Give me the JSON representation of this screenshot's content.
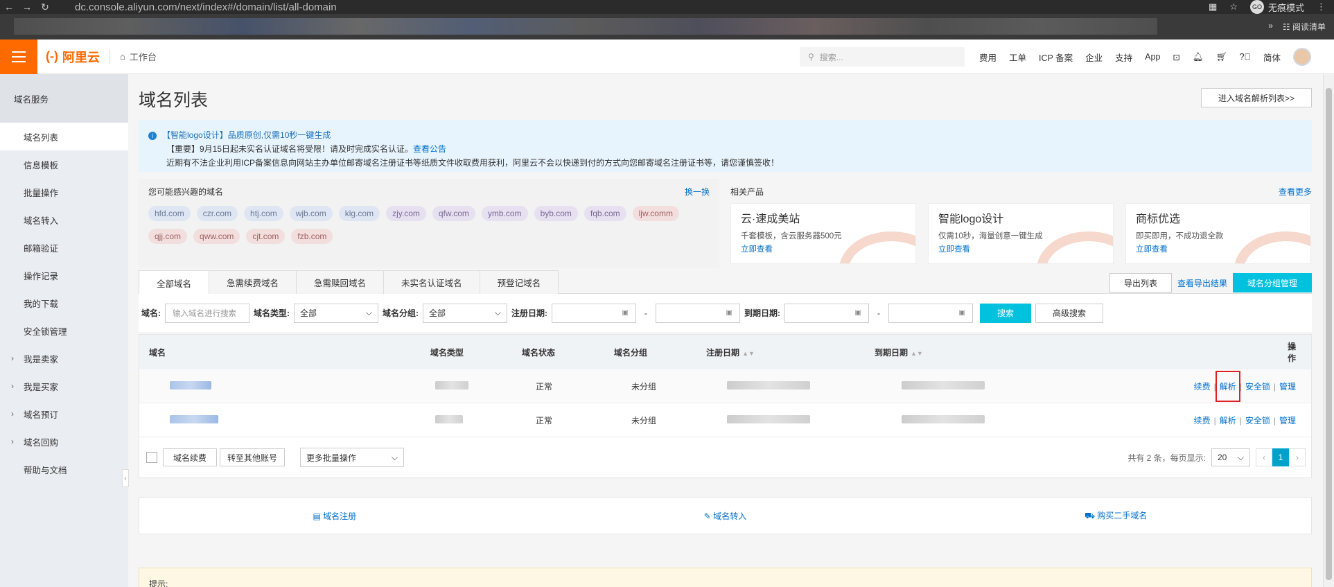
{
  "browser": {
    "url": "dc.console.aliyun.com/next/index#/domain/list/all-domain",
    "incognito_label": "无痕模式",
    "reading_list": "阅读清单",
    "incognito_badge": "GO"
  },
  "topbar": {
    "logo_mark": "(-)",
    "logo_text": "阿里云",
    "workbench": "工作台",
    "search_placeholder": "搜索...",
    "links": [
      "费用",
      "工单",
      "ICP 备案",
      "企业",
      "支持",
      "App"
    ],
    "lang": "简体"
  },
  "sidebar": {
    "title": "域名服务",
    "items": [
      {
        "label": "域名列表",
        "active": true,
        "group": false
      },
      {
        "label": "信息模板",
        "active": false,
        "group": false
      },
      {
        "label": "批量操作",
        "active": false,
        "group": false
      },
      {
        "label": "域名转入",
        "active": false,
        "group": false
      },
      {
        "label": "邮箱验证",
        "active": false,
        "group": false
      },
      {
        "label": "操作记录",
        "active": false,
        "group": false
      },
      {
        "label": "我的下载",
        "active": false,
        "group": false
      },
      {
        "label": "安全锁管理",
        "active": false,
        "group": false
      },
      {
        "label": "我是卖家",
        "active": false,
        "group": true
      },
      {
        "label": "我是买家",
        "active": false,
        "group": true
      },
      {
        "label": "域名预订",
        "active": false,
        "group": true
      },
      {
        "label": "域名回购",
        "active": false,
        "group": true
      },
      {
        "label": "帮助与文档",
        "active": false,
        "group": false
      }
    ]
  },
  "main": {
    "title": "域名列表",
    "top_right_button": "进入域名解析列表>>",
    "notice": {
      "line1": "【智能logo设计】品质原创,仅需10秒一键生成",
      "line2": "【重要】9月15日起未实名认证域名将受限！请及时完成实名认证。",
      "line2_link": "查看公告",
      "line3": "近期有不法企业利用ICP备案信息向网站主办单位邮寄域名注册证书等纸质文件收取费用获利，阿里云不会以快递到付的方式向您邮寄域名注册证书等，请您谨慎签收！"
    },
    "interest": {
      "title": "您可能感兴趣的域名",
      "refresh": "换一换",
      "tags": [
        {
          "text": "hfd.com",
          "tone": "blue"
        },
        {
          "text": "czr.com",
          "tone": "blue"
        },
        {
          "text": "htj.com",
          "tone": "blue"
        },
        {
          "text": "wjb.com",
          "tone": "blue"
        },
        {
          "text": "klg.com",
          "tone": "blue"
        },
        {
          "text": "zjy.com",
          "tone": "purple"
        },
        {
          "text": "qfw.com",
          "tone": "purple"
        },
        {
          "text": "ymb.com",
          "tone": "purple"
        },
        {
          "text": "byb.com",
          "tone": "purple"
        },
        {
          "text": "fqb.com",
          "tone": "purple"
        },
        {
          "text": "ljw.comm",
          "tone": "pink"
        },
        {
          "text": "qjj.com",
          "tone": "pink"
        },
        {
          "text": "qww.com",
          "tone": "pink"
        },
        {
          "text": "cjt.com",
          "tone": "pink"
        },
        {
          "text": "fzb.com",
          "tone": "pink"
        }
      ]
    },
    "related": {
      "title": "相关产品",
      "more": "查看更多",
      "cards": [
        {
          "title": "云·速成美站",
          "desc": "千套模板，含云服务器500元",
          "link": "立即查看"
        },
        {
          "title": "智能logo设计",
          "desc": "仅需10秒，海量创意一键生成",
          "link": "立即查看"
        },
        {
          "title": "商标优选",
          "desc": "即买即用，不成功退全款",
          "link": "立即查看"
        }
      ]
    },
    "tabs": [
      "全部域名",
      "急需续费域名",
      "急需赎回域名",
      "未实名认证域名",
      "预登记域名"
    ],
    "tab_actions": {
      "export": "导出列表",
      "export_results": "查看导出结果",
      "group_manage": "域名分组管理"
    },
    "filters": {
      "domain_label": "域名:",
      "domain_placeholder": "输入域名进行搜索",
      "type_label": "域名类型:",
      "type_value": "全部",
      "group_label": "域名分组:",
      "group_value": "全部",
      "reg_label": "注册日期:",
      "exp_label": "到期日期:",
      "dash": "-",
      "search": "搜索",
      "advanced": "高级搜索"
    },
    "table": {
      "headers": [
        "域名",
        "域名类型",
        "域名状态",
        "域名分组",
        "注册日期",
        "到期日期",
        "操作"
      ],
      "rows": [
        {
          "status": "正常",
          "group": "未分组",
          "ops": [
            "续费",
            "解析",
            "安全锁",
            "管理"
          ]
        },
        {
          "status": "正常",
          "group": "未分组",
          "ops": [
            "续费",
            "解析",
            "安全锁",
            "管理"
          ]
        }
      ],
      "footer": {
        "renew": "域名续费",
        "transfer": "转至其他账号",
        "more_batch": "更多批量操作",
        "total": "共有 2 条，每页显示:",
        "page_size": "20",
        "current_page": "1"
      }
    },
    "quick_links": [
      "域名注册",
      "域名转入",
      "购买二手域名"
    ],
    "tip_title": "提示:"
  }
}
